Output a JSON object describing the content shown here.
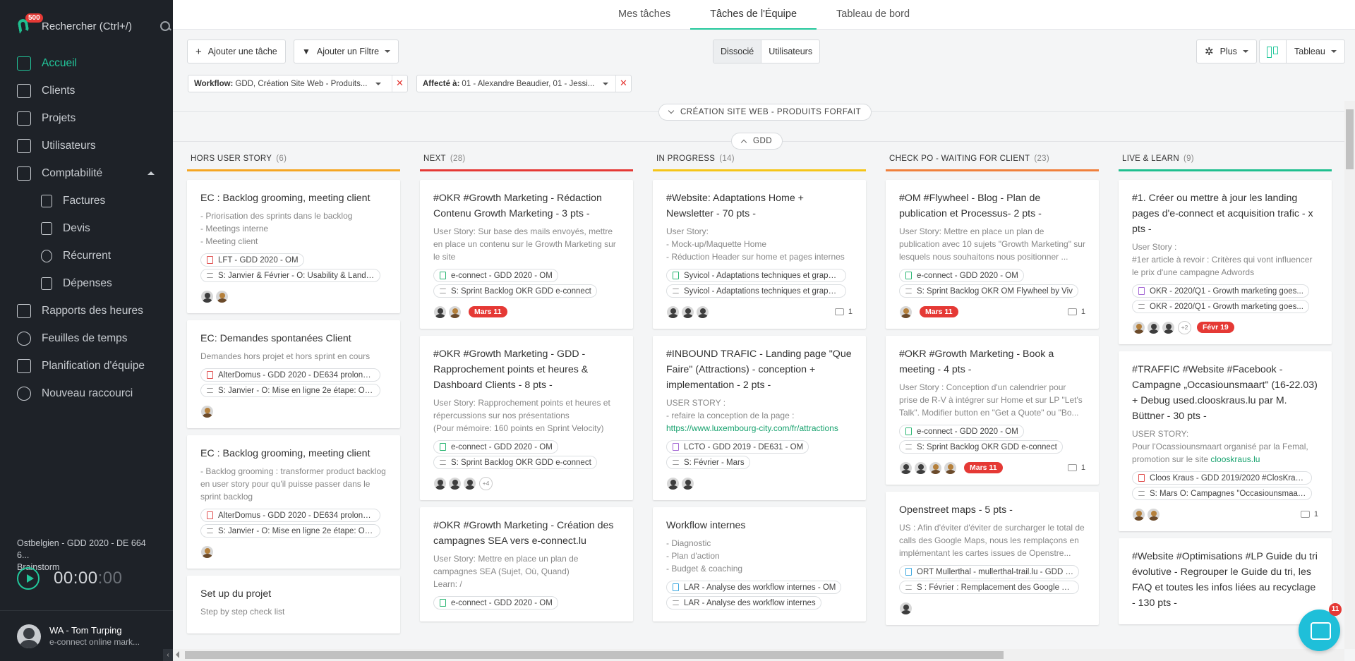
{
  "sidebar": {
    "notif_count": "500",
    "search_label": "Rechercher (Ctrl+/)",
    "items": [
      {
        "label": "Accueil",
        "icon": "home-icon",
        "active": true
      },
      {
        "label": "Clients",
        "icon": "building-icon"
      },
      {
        "label": "Projets",
        "icon": "folder-icon"
      },
      {
        "label": "Utilisateurs",
        "icon": "user-icon"
      },
      {
        "label": "Comptabilité",
        "icon": "accounting-icon"
      },
      {
        "label": "Factures",
        "icon": "invoice-icon",
        "sub": true
      },
      {
        "label": "Devis",
        "icon": "quote-icon",
        "sub": true
      },
      {
        "label": "Récurrent",
        "icon": "recurring-icon",
        "sub": true
      },
      {
        "label": "Dépenses",
        "icon": "expenses-icon",
        "sub": true
      },
      {
        "label": "Rapports des heures",
        "icon": "reports-icon"
      },
      {
        "label": "Feuilles de temps",
        "icon": "clock-icon"
      },
      {
        "label": "Planification d'équipe",
        "icon": "calendar-icon"
      },
      {
        "label": "Nouveau raccourci",
        "icon": "plus-circle-icon"
      }
    ],
    "project_label": "Ostbelgien - GDD 2020 - DE 664 6...",
    "project_task": "Brainstorm",
    "timer_hm": "00:00",
    "timer_sec": ":00",
    "user_name": "WA - Tom Turping",
    "user_org": "e-connect online mark..."
  },
  "tabs": [
    "Mes tâches",
    "Tâches de l'Équipe",
    "Tableau de bord"
  ],
  "toolbar": {
    "add_task": "Ajouter une tâche",
    "add_filter": "Ajouter un Filtre",
    "seg_dissocie": "Dissocié",
    "seg_users": "Utilisateurs",
    "more": "Plus",
    "view": "Tableau"
  },
  "filters": [
    {
      "key": "Workflow:",
      "value": "GDD, Création Site Web - Produits..."
    },
    {
      "key": "Affecté à:",
      "value": "01 - Alexandre Beaudier, 01 - Jessi..."
    }
  ],
  "groups": {
    "collapsed": "CRÉATION SITE WEB - PRODUITS FORFAIT",
    "expanded": "GDD"
  },
  "columns": [
    {
      "name": "HORS USER STORY",
      "count": "(6)",
      "color": "#f5a623",
      "cards": [
        {
          "title": "EC : Backlog grooming, meeting client",
          "desc": "- Priorisation des sprints dans le backlog\n- Meetings interne\n- Meeting client",
          "tags": [
            {
              "c": "red",
              "t": "LFT - GDD 2020 - OM"
            },
            {
              "c": "gray",
              "t": "S: Janvier & Février - O: Usability & Landing..."
            }
          ],
          "avatars": [
            "m",
            "f"
          ]
        },
        {
          "title": "EC: Demandes spontanées Client",
          "desc": "Demandes hors projet et hors sprint en cours",
          "tags": [
            {
              "c": "red",
              "t": "AlterDomus - GDD 2020 - DE634 prolongation..."
            },
            {
              "c": "gray",
              "t": "S: Janvier - O: Mise en ligne 2e étape: Offre..."
            }
          ],
          "avatars": [
            "f"
          ]
        },
        {
          "title": "EC : Backlog grooming, meeting client",
          "desc": "- Backlog grooming : transformer product backlog en user story pour qu'il puisse passer dans le sprint backlog",
          "tags": [
            {
              "c": "red",
              "t": "AlterDomus - GDD 2020 - DE634 prolongation..."
            },
            {
              "c": "gray",
              "t": "S: Janvier - O: Mise en ligne 2e étape: Offre..."
            }
          ],
          "avatars": [
            "f"
          ]
        },
        {
          "title": "Set up du projet",
          "desc": "Step by step check list",
          "tags": [],
          "avatars": []
        }
      ]
    },
    {
      "name": "NEXT",
      "count": "(28)",
      "color": "#e53935",
      "cards": [
        {
          "title": "#OKR #Growth Marketing - Rédaction Contenu Growth Marketing - 3 pts -",
          "desc": "User Story: Sur base des mails envoyés, mettre en place un contenu sur le Growth Marketing sur le site",
          "tags": [
            {
              "c": "green",
              "t": "e-connect - GDD 2020 - OM"
            },
            {
              "c": "gray",
              "t": "S: Sprint Backlog OKR GDD e-connect"
            }
          ],
          "avatars": [
            "m",
            "f"
          ],
          "due": "Mars 11"
        },
        {
          "title": "#OKR #Growth Marketing - GDD - Rapprochement points et heures & Dashboard Clients - 8 pts -",
          "desc": "User Story: Rapprochement points et heures et répercussions sur nos présentations\n(Pour mémoire: 160 points en Sprint Velocity)",
          "tags": [
            {
              "c": "green",
              "t": "e-connect - GDD 2020 - OM"
            },
            {
              "c": "gray",
              "t": "S: Sprint Backlog OKR GDD e-connect"
            }
          ],
          "avatars": [
            "m",
            "m",
            "m"
          ],
          "more": "+4"
        },
        {
          "title": "#OKR #Growth Marketing - Création des campagnes SEA vers e-connect.lu",
          "desc": "User Story: Mettre en place un plan de campagnes SEA (Sujet, Où, Quand)\nLearn: /",
          "tags": [
            {
              "c": "green",
              "t": "e-connect - GDD 2020 - OM"
            }
          ],
          "avatars": []
        }
      ]
    },
    {
      "name": "IN PROGRESS",
      "count": "(14)",
      "color": "#f5c518",
      "cards": [
        {
          "title": "#Website: Adaptations Home + Newsletter - 70 pts -",
          "desc": "User Story:\n- Mock-up/Maquette Home\n- Réduction Header sur home et pages internes",
          "tags": [
            {
              "c": "green",
              "t": "Syvicol - Adaptations techniques et graphiques..."
            },
            {
              "c": "gray",
              "t": "Syvicol - Adaptations techniques et graphiques..."
            }
          ],
          "avatars": [
            "m",
            "m",
            "m"
          ],
          "comments": "1"
        },
        {
          "title": "#INBOUND TRAFIC - Landing page \"Que Faire\" (Attractions) - conception + implementation - 2 pts -",
          "desc": "USER STORY :\n- refaire la conception de la page :",
          "link": "https://www.luxembourg-city.com/fr/attractions",
          "tags": [
            {
              "c": "purple",
              "t": "LCTO - GDD 2019 - DE631 - OM"
            },
            {
              "c": "gray",
              "t": "S: Février - Mars"
            }
          ],
          "avatars": [
            "m",
            "m"
          ]
        },
        {
          "title": "Workflow internes",
          "desc": "- Diagnostic\n- Plan d'action\n- Budget & coaching",
          "tags": [
            {
              "c": "blue",
              "t": "LAR - Analyse des workflow internes - OM"
            },
            {
              "c": "gray",
              "t": "LAR - Analyse des workflow internes"
            }
          ],
          "avatars": []
        }
      ]
    },
    {
      "name": "CHECK PO - WAITING FOR CLIENT",
      "count": "(23)",
      "color": "#f0803c",
      "cards": [
        {
          "title": "#OM #Flywheel  - Blog - Plan de publication et Processus- 2 pts -",
          "desc": "User Story: Mettre en place un plan de publication avec 10 sujets \"Growth Marketing\" sur lesquels nous souhaitons nous positionner ...",
          "tags": [
            {
              "c": "green",
              "t": "e-connect - GDD 2020 - OM"
            },
            {
              "c": "gray",
              "t": "S: Sprint Backlog OKR OM Flywheel by Viv"
            }
          ],
          "avatars": [
            "f"
          ],
          "due": "Mars 11",
          "comments": "1"
        },
        {
          "title": "#OKR #Growth Marketing - Book a meeting - 4 pts -",
          "desc": "User Story : Conception d'un calendrier pour prise de R-V à intégrer sur Home et sur LP \"Let's Talk\". Modifier button en \"Get a Quote\" ou \"Bo...",
          "tags": [
            {
              "c": "green",
              "t": "e-connect - GDD 2020 - OM"
            },
            {
              "c": "gray",
              "t": "S: Sprint Backlog OKR GDD e-connect"
            }
          ],
          "avatars": [
            "m",
            "m",
            "f",
            "f"
          ],
          "due": "Mars 11",
          "comments": "1"
        },
        {
          "title": "Openstreet maps - 5 pts -",
          "desc": "US : Afin d'éviter d'éviter de surcharger le total de calls des Google Maps, nous les remplaçons en implémentant les cartes issues de Openstre...",
          "tags": [
            {
              "c": "blue",
              "t": "ORT Mullerthal - mullerthal-trail.lu - GDD 2020..."
            },
            {
              "c": "gray",
              "t": "S : Février : Remplacement des Google Maps..."
            }
          ],
          "avatars": [
            "m"
          ]
        }
      ]
    },
    {
      "name": "LIVE & LEARN",
      "count": "(9)",
      "color": "#1fbf8f",
      "cards": [
        {
          "title": "#1. Créer ou mettre à jour les landing pages d'e-connect et acquisition trafic - x pts -",
          "desc": "User Story :\n#1er article à revoir : Critères qui vont influencer le prix d'une campagne Adwords",
          "tags": [
            {
              "c": "purple",
              "t": "OKR - 2020/Q1 - Growth marketing goes..."
            },
            {
              "c": "gray",
              "t": "OKR - 2020/Q1 - Growth marketing goes..."
            }
          ],
          "avatars": [
            "f",
            "m",
            "m"
          ],
          "more": "+2",
          "due": "Févr 19"
        },
        {
          "title": "#TRAFFIC #Website #Facebook - Campagne „Occasiounsmaart\" (16-22.03) + Debug used.clooskraus.lu par M. Büttner - 30 pts -",
          "desc": "USER STORY:\nPour l'Ocassiounsmaart organisé par la Femal, promotion sur le site",
          "link": "clooskraus.lu",
          "tags": [
            {
              "c": "red",
              "t": "Cloos Kraus - GDD 2019/2020 #ClosKraus..."
            },
            {
              "c": "gray",
              "t": "S: Mars O: Campagnes \"Occasiounsmaart\"..."
            }
          ],
          "avatars": [
            "f",
            "f"
          ],
          "comments": "1"
        },
        {
          "title": "#Website #Optimisations #LP Guide du tri évolutive - Regrouper le Guide du tri, les FAQ et toutes les infos liées au recyclage - 130 pts -",
          "desc": "",
          "tags": [],
          "avatars": []
        }
      ]
    }
  ],
  "chat_count": "11"
}
